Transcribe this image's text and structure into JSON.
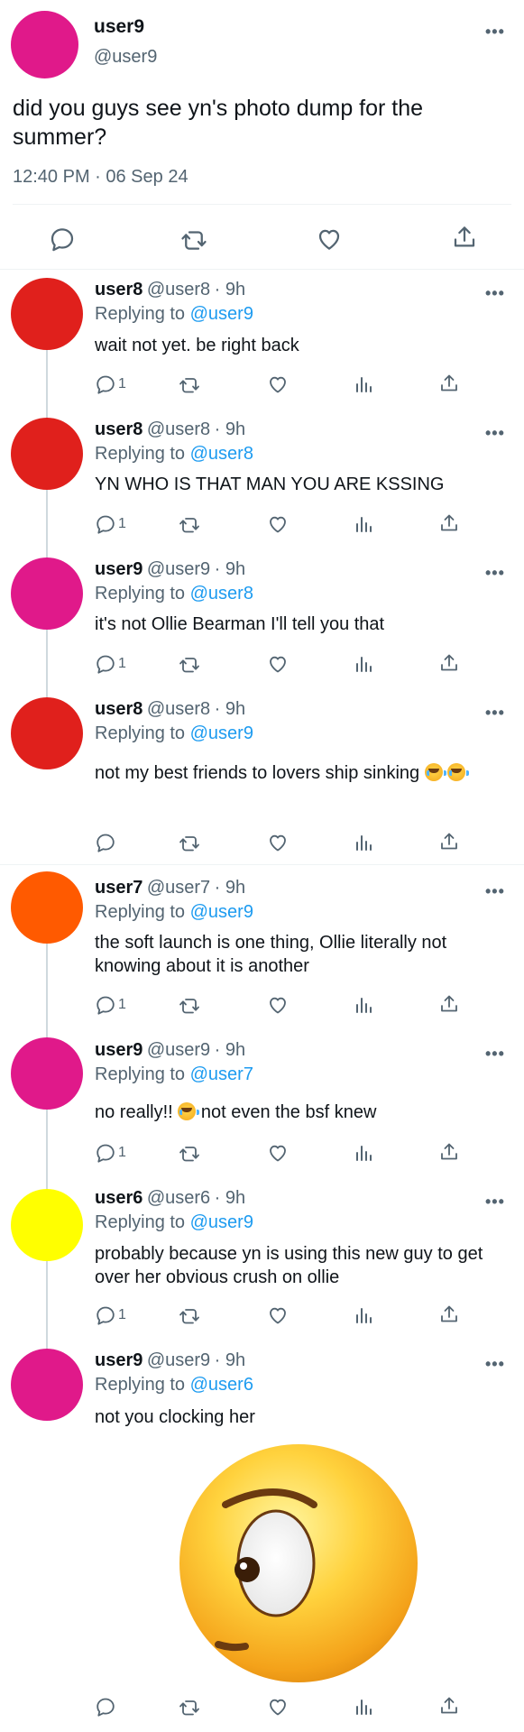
{
  "main_tweet": {
    "name": "user9",
    "handle": "@user9",
    "avatar_color": "#e0198a",
    "text": "did you guys see yn's photo dump for the summer?",
    "time": "12:40 PM · 06 Sep 24"
  },
  "colors": {
    "text": "#0f1419",
    "secondary": "#536471",
    "link": "#1d9bf0",
    "thread_line": "#cfd9de"
  },
  "replies": [
    {
      "name": "user8",
      "handle": "@user8",
      "age": "· 9h",
      "reply_label": "Replying to",
      "reply_to": "@user9",
      "text": "wait not yet. be right back",
      "reply_count": "1",
      "avatar_color": "#e0201c"
    },
    {
      "name": "user8",
      "handle": "@user8",
      "age": "· 9h",
      "reply_label": "Replying to",
      "reply_to": "@user8",
      "text": "YN WHO IS THAT MAN YOU ARE KSSING",
      "reply_count": "1",
      "avatar_color": "#e0201c"
    },
    {
      "name": "user9",
      "handle": "@user9",
      "age": "· 9h",
      "reply_label": "Replying to",
      "reply_to": "@user8",
      "text": "it's not Ollie Bearman I'll tell you that",
      "reply_count": "1",
      "avatar_color": "#e0198a"
    },
    {
      "name": "user8",
      "handle": "@user8",
      "age": "· 9h",
      "reply_label": "Replying to",
      "reply_to": "@user9",
      "text": "not my best friends to lovers ship sinking",
      "reply_count": "",
      "avatar_color": "#e0201c"
    },
    {
      "name": "user7",
      "handle": "@user7",
      "age": "· 9h",
      "reply_label": "Replying to",
      "reply_to": "@user9",
      "text": "the soft launch is one thing, Ollie literally not knowing about it is another",
      "reply_count": "1",
      "avatar_color": "#ff5a00"
    },
    {
      "name": "user9",
      "handle": "@user9",
      "age": "· 9h",
      "reply_label": "Replying to",
      "reply_to": "@user7",
      "text_a": "no really!!",
      "text_b": "not even the bsf knew",
      "reply_count": "1",
      "avatar_color": "#e0198a"
    },
    {
      "name": "user6",
      "handle": "@user6",
      "age": "· 9h",
      "reply_label": "Replying to",
      "reply_to": "@user9",
      "text": "probably because yn is using this new guy to get over her obvious crush on ollie",
      "reply_count": "1",
      "avatar_color": "#ffff00"
    },
    {
      "name": "user9",
      "handle": "@user9",
      "age": "· 9h",
      "reply_label": "Replying to",
      "reply_to": "@user6",
      "text": "not you clocking her",
      "reply_count": "",
      "avatar_color": "#e0198a"
    }
  ],
  "icons": [
    "more-icon",
    "reply-icon",
    "retweet-icon",
    "like-icon",
    "views-icon",
    "share-icon"
  ]
}
